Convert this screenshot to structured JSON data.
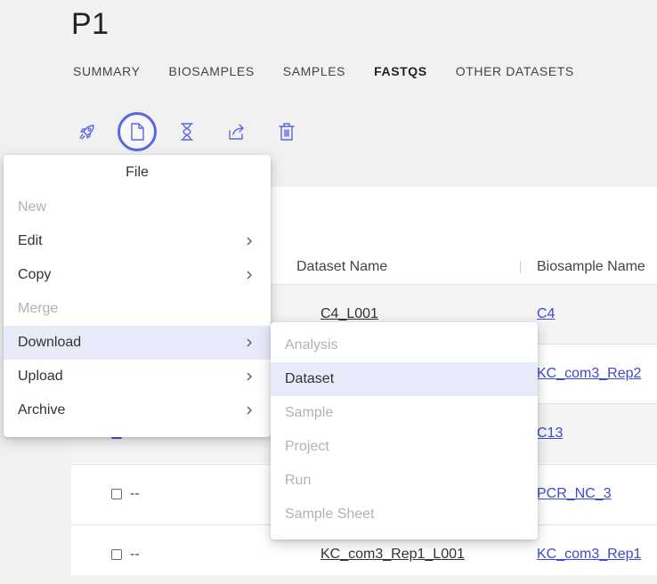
{
  "project": {
    "title": "P1"
  },
  "tabs": [
    {
      "label": "SUMMARY",
      "active": false
    },
    {
      "label": "BIOSAMPLES",
      "active": false
    },
    {
      "label": "SAMPLES",
      "active": false
    },
    {
      "label": "FASTQS",
      "active": true
    },
    {
      "label": "OTHER DATASETS",
      "active": false
    }
  ],
  "toolbar": {
    "icons": [
      "rocket-icon",
      "file-icon",
      "hourglass-icon",
      "share-icon",
      "trash-icon"
    ],
    "selected": "file-icon",
    "accent": "#5a67e3"
  },
  "table": {
    "columns": [
      "Dataset Name",
      "Biosample Name"
    ],
    "rows": [
      {
        "dataset": "C4_L001",
        "biosample": "C4",
        "checked": false,
        "dash": ""
      },
      {
        "dataset": "",
        "biosample": "KC_com3_Rep2",
        "checked": false,
        "dash": ""
      },
      {
        "dataset": "",
        "biosample": "C13",
        "checked": true,
        "dash": ""
      },
      {
        "dataset": "",
        "biosample": "PCR_NC_3",
        "checked": false,
        "dash": "--"
      },
      {
        "dataset": "KC_com3_Rep1_L001",
        "biosample": "KC_com3_Rep1",
        "checked": false,
        "dash": "--"
      }
    ],
    "link_color": "#3b49d4"
  },
  "file_menu": {
    "title": "File",
    "items": [
      {
        "label": "New",
        "disabled": true,
        "submenu": false
      },
      {
        "label": "Edit",
        "disabled": false,
        "submenu": true
      },
      {
        "label": "Copy",
        "disabled": false,
        "submenu": true
      },
      {
        "label": "Merge",
        "disabled": true,
        "submenu": false
      },
      {
        "label": "Download",
        "disabled": false,
        "submenu": true,
        "highlighted": true
      },
      {
        "label": "Upload",
        "disabled": false,
        "submenu": true
      },
      {
        "label": "Archive",
        "disabled": false,
        "submenu": true
      }
    ]
  },
  "download_submenu": {
    "items": [
      {
        "label": "Analysis",
        "disabled": true
      },
      {
        "label": "Dataset",
        "disabled": false,
        "highlighted": true
      },
      {
        "label": "Sample",
        "disabled": true
      },
      {
        "label": "Project",
        "disabled": true
      },
      {
        "label": "Run",
        "disabled": true
      },
      {
        "label": "Sample Sheet",
        "disabled": true
      }
    ]
  },
  "highlight_color": "#e8eaf9"
}
